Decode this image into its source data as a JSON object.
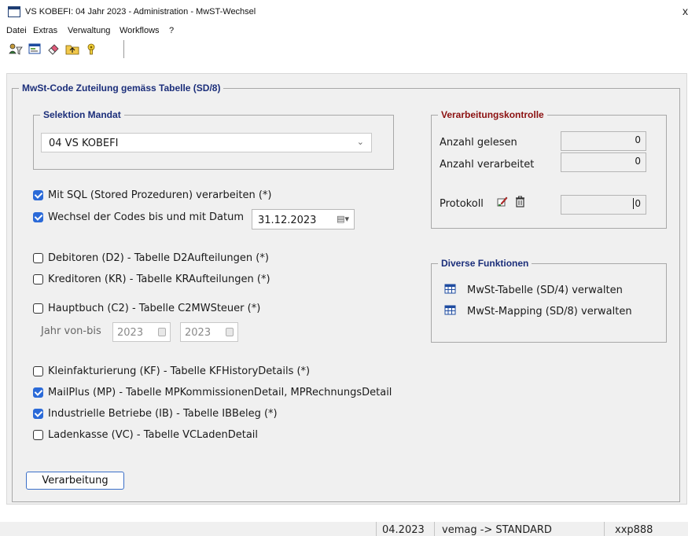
{
  "window": {
    "title": "VS KOBEFI: 04 Jahr 2023  - Administration - MwST-Wechsel",
    "close_glyph": "x"
  },
  "menu": [
    "Datei",
    "Extras",
    "Verwaltung",
    "Workflows",
    "?"
  ],
  "toolbar": {
    "icons": [
      "user-filter-icon",
      "form-window-icon",
      "eraser-icon",
      "folder-up-icon",
      "help-icon"
    ]
  },
  "main_group": {
    "title": "MwSt-Code Zuteilung gemäss Tabelle (SD/8)"
  },
  "selektion": {
    "title": "Selektion Mandat",
    "selected": "04 VS KOBEFI"
  },
  "options": {
    "sql": {
      "label": "Mit SQL (Stored Prozeduren) verarbeiten (*)",
      "checked": true
    },
    "wechsel": {
      "label": "Wechsel der Codes bis und mit Datum",
      "checked": true,
      "date": "31.12.2023"
    },
    "debitoren": {
      "label": "Debitoren (D2) - Tabelle D2Aufteilungen (*)",
      "checked": false
    },
    "kreditoren": {
      "label": "Kreditoren (KR) - Tabelle KRAufteilungen (*)",
      "checked": false
    },
    "hauptbuch": {
      "label": "Hauptbuch (C2) - Tabelle C2MWSteuer (*)",
      "checked": false
    },
    "jahr": {
      "label": "Jahr von-bis",
      "from": "2023",
      "to": "2023"
    },
    "klein": {
      "label": "Kleinfakturierung (KF) - Tabelle KFHistoryDetails (*)",
      "checked": false
    },
    "mailplus": {
      "label": "MailPlus (MP) - Tabelle MPKommissionenDetail, MPRechnungsDetail",
      "checked": true
    },
    "industrie": {
      "label": "Industrielle Betriebe (IB) - Tabelle IBBeleg (*)",
      "checked": true
    },
    "laden": {
      "label": "Ladenkasse (VC) - Tabelle VCLadenDetail",
      "checked": false
    }
  },
  "kontrolle": {
    "title": "Verarbeitungskontrolle",
    "gelesen_label": "Anzahl gelesen",
    "gelesen_value": "0",
    "verarbeitet_label": "Anzahl verarbeitet",
    "verarbeitet_value": "0",
    "protokoll_label": "Protokoll",
    "protokoll_value": "0"
  },
  "funktionen": {
    "title": "Diverse Funktionen",
    "items": [
      "MwSt-Tabelle (SD/4) verwalten",
      "MwSt-Mapping (SD/8) verwalten"
    ]
  },
  "buttons": {
    "run": "Verarbeitung"
  },
  "status": {
    "period": "04.2023",
    "connection": "vemag -> STANDARD",
    "user": "xxp888"
  },
  "colors": {
    "group_blue": "#1b2e7a",
    "group_red": "#8b1010",
    "check_blue": "#2b6ad8",
    "button_border": "#3a6fc8"
  }
}
